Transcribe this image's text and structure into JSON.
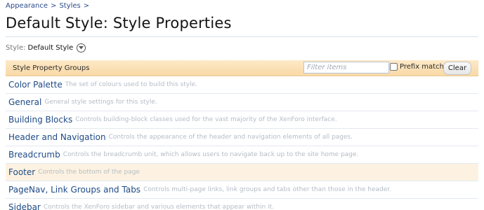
{
  "breadcrumb": [
    {
      "label": "Appearance"
    },
    {
      "label": "Styles"
    }
  ],
  "breadcrumb_separator": ">",
  "page_title": "Default Style: Style Properties",
  "style_selector": {
    "label": "Style:",
    "value": "Default Style"
  },
  "group_header": {
    "label": "Style Property Groups",
    "filter_placeholder": "Filter items",
    "filter_value": "",
    "prefix_label": "Prefix match",
    "prefix_checked": false,
    "clear_label": "Clear"
  },
  "groups": [
    {
      "name": "Color Palette",
      "description": "The set of colours used to build this style."
    },
    {
      "name": "General",
      "description": "General style settings for this style."
    },
    {
      "name": "Building Blocks",
      "description": "Controls building-block classes used for the vast majority of the XenForo interface."
    },
    {
      "name": "Header and Navigation",
      "description": "Controls the appearance of the header and navigation elements of all pages."
    },
    {
      "name": "Breadcrumb",
      "description": "Controls the breadcrumb unit, which allows users to navigate back up to the site home page."
    },
    {
      "name": "Footer",
      "description": "Controls the bottom of the page",
      "highlighted": true
    },
    {
      "name": "PageNav, Link Groups and Tabs",
      "description": "Controls multi-page links, link groups and tabs other than those in the header."
    },
    {
      "name": "Sidebar",
      "description": "Controls the XenForo sidebar and various elements that appear within it."
    }
  ],
  "colors": {
    "link": "#2b4a8b",
    "header_band": "#fde9c8",
    "row_highlight": "#fdf2e1",
    "muted_text": "#b4bcc6"
  }
}
